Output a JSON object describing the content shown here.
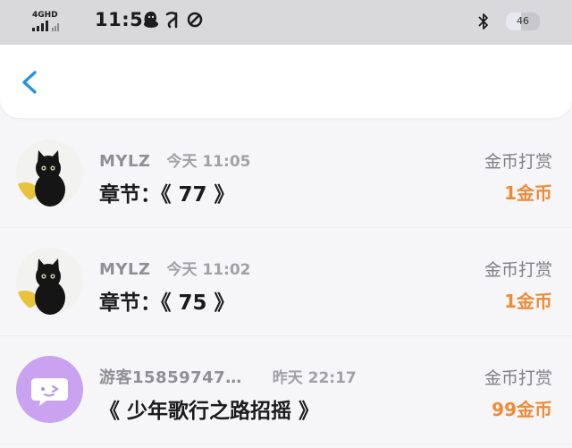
{
  "status_bar": {
    "network": "4GHD",
    "time": "11:56",
    "battery": "46",
    "battery_level": 0.46,
    "icons": [
      "qq-icon",
      "telecom-icon",
      "sync-icon",
      "bluetooth-icon",
      "battery-icon"
    ]
  },
  "nav": {
    "back_icon": "chevron-left-icon"
  },
  "colors": {
    "accent": "#2b93de",
    "amount": "#f08a35",
    "guest_avatar_bg": "#c9a3ef"
  },
  "records": [
    {
      "avatar": "black-cat-avatar",
      "name": "MYLZ",
      "time": "今天 11:05",
      "chapter": "章节：《 77 》",
      "tip_label": "金币打赏",
      "amount": "1金币"
    },
    {
      "avatar": "black-cat-avatar",
      "name": "MYLZ",
      "time": "今天 11:02",
      "chapter": "章节：《 75 》",
      "tip_label": "金币打赏",
      "amount": "1金币"
    },
    {
      "avatar": "chat-bubble-avatar",
      "name": "游客15859747…",
      "time": "昨天 22:17",
      "chapter": "《 少年歌行之路招摇 》",
      "tip_label": "金币打赏",
      "amount": "99金币"
    }
  ]
}
